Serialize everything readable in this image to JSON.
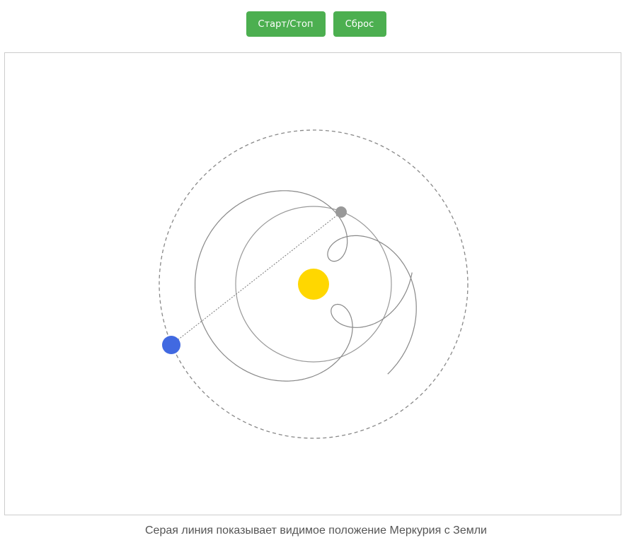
{
  "controls": {
    "start_stop_label": "Старт/Стоп",
    "reset_label": "Сброс",
    "button_color": "#4caf50"
  },
  "simulation": {
    "sun_color": "#ffd700",
    "earth_color": "#4169e1",
    "mercury_color": "#999999",
    "path_color": "#888888",
    "earth_orbit_line_color": "#888888"
  },
  "caption": "Серая линия показывает видимое положение Меркурия с Земли"
}
